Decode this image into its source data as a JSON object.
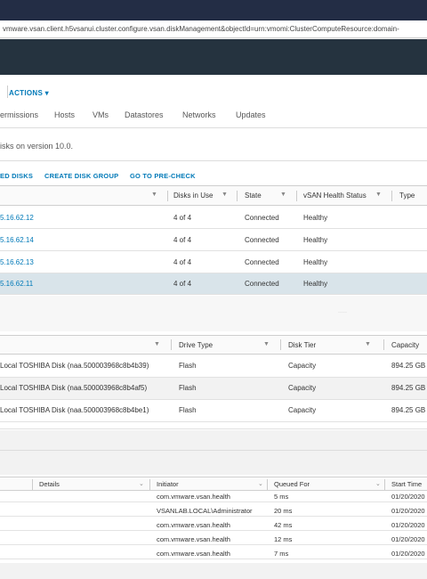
{
  "browser": {
    "url": "vmware.vsan.client.h5vsanui.cluster.configure.vsan.diskManagement&objectId=urn:vmomi:ClusterComputeResource:domain-"
  },
  "toolbar": {
    "actions_label": "ACTIONS ▾"
  },
  "tabs": [
    "ermissions",
    "Hosts",
    "VMs",
    "Datastores",
    "Networks",
    "Updates"
  ],
  "info": {
    "version_text": "isks on version 10.0."
  },
  "disk_actions": [
    "ED DISKS",
    "CREATE DISK GROUP",
    "GO TO PRE-CHECK"
  ],
  "hosts_grid": {
    "headers": [
      "",
      "Disks in Use",
      "State",
      "vSAN Health Status",
      "Type"
    ],
    "rows": [
      {
        "host": "5.16.62.12",
        "disks": "4 of 4",
        "state": "Connected",
        "health": "Healthy"
      },
      {
        "host": "5.16.62.14",
        "disks": "4 of 4",
        "state": "Connected",
        "health": "Healthy"
      },
      {
        "host": "5.16.62.13",
        "disks": "4 of 4",
        "state": "Connected",
        "health": "Healthy"
      },
      {
        "host": "5.16.62.11",
        "disks": "4 of 4",
        "state": "Connected",
        "health": "Healthy"
      }
    ]
  },
  "disks_grid": {
    "headers": [
      "",
      "Drive Type",
      "Disk Tier",
      "Capacity"
    ],
    "rows": [
      {
        "name": "Local TOSHIBA Disk (naa.500003968c8b4b39)",
        "drive": "Flash",
        "tier": "Capacity",
        "capacity": "894.25 GB"
      },
      {
        "name": "Local TOSHIBA Disk (naa.500003968c8b4af5)",
        "drive": "Flash",
        "tier": "Capacity",
        "capacity": "894.25 GB"
      },
      {
        "name": "Local TOSHIBA Disk (naa.500003968c8b4be1)",
        "drive": "Flash",
        "tier": "Capacity",
        "capacity": "894.25 GB"
      }
    ]
  },
  "tasks_grid": {
    "headers": [
      "Details",
      "Initiator",
      "Queued For",
      "Start Time"
    ],
    "rows": [
      {
        "initiator": "com.vmware.vsan.health",
        "queued": "5 ms",
        "start": "01/20/2020"
      },
      {
        "initiator": "VSANLAB.LOCAL\\Administrator",
        "queued": "20 ms",
        "start": "01/20/2020"
      },
      {
        "initiator": "com.vmware.vsan.health",
        "queued": "42 ms",
        "start": "01/20/2020"
      },
      {
        "initiator": "com.vmware.vsan.health",
        "queued": "12 ms",
        "start": "01/20/2020"
      },
      {
        "initiator": "com.vmware.vsan.health",
        "queued": "7 ms",
        "start": "01/20/2020"
      }
    ]
  },
  "icons": {
    "filter": "filter-icon",
    "caret": "caret-down-icon"
  }
}
